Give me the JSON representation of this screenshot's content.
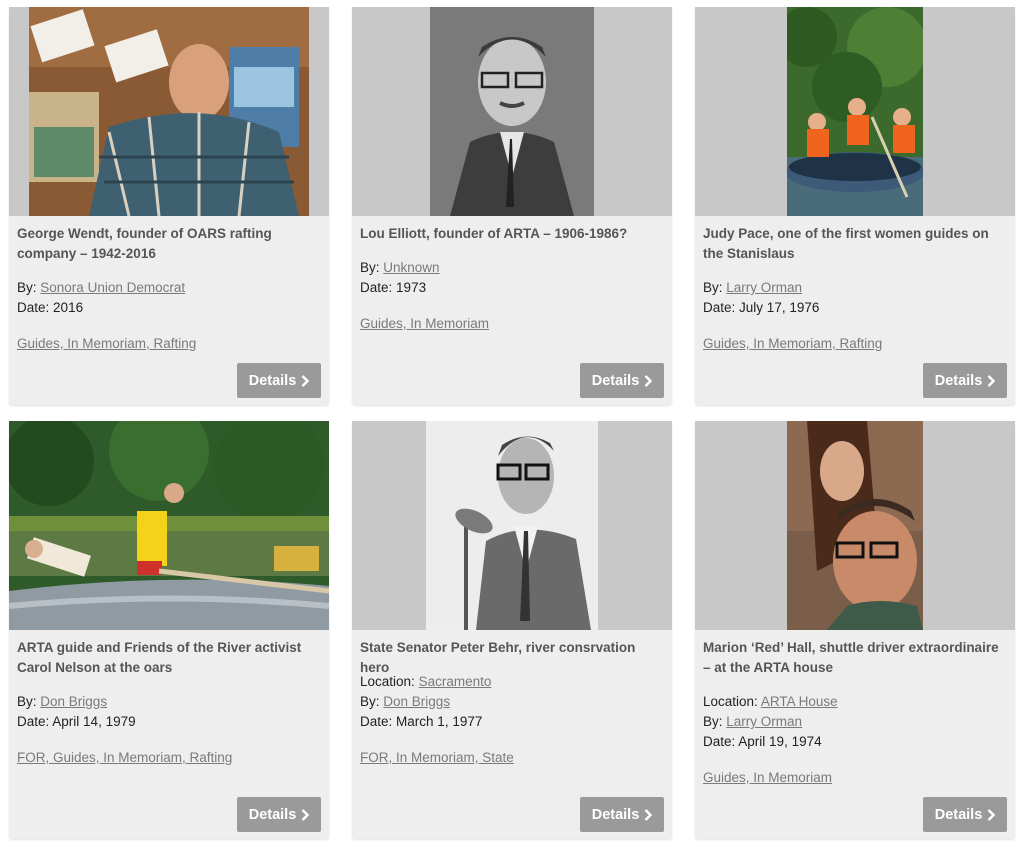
{
  "details_label": "Details",
  "cards": [
    {
      "title": "George Wendt, founder of OARS rafting company – 1942-2016",
      "by_label": "By:",
      "by": "Sonora Union Democrat",
      "date_label": "Date:",
      "date": "2016",
      "categories": "Guides, In Memoriam, Rafting",
      "photo": "photo-george-wendt"
    },
    {
      "title": "Lou Elliott, founder of ARTA – 1906-1986?",
      "by_label": "By:",
      "by": "Unknown",
      "date_label": "Date:",
      "date": "1973",
      "categories": "Guides, In Memoriam",
      "photo": "photo-lou-elliott"
    },
    {
      "title": "Judy Pace, one of the first women guides on the Stanislaus",
      "by_label": "By:",
      "by": "Larry Orman",
      "date_label": "Date:",
      "date": "July 17, 1976",
      "categories": "Guides, In Memoriam, Rafting",
      "photo": "photo-judy-pace"
    },
    {
      "title": "ARTA guide and Friends of the River activist Carol Nelson at the oars",
      "by_label": "By:",
      "by": "Don Briggs",
      "date_label": "Date:",
      "date": "April 14, 1979",
      "categories": "FOR, Guides, In Memoriam, Rafting",
      "photo": "photo-carol-nelson"
    },
    {
      "title": "State Senator Peter Behr, river consrvation hero",
      "location_label": "Location:",
      "location": "Sacramento",
      "by_label": "By:",
      "by": "Don Briggs",
      "date_label": "Date:",
      "date": "March 1, 1977",
      "categories": "FOR, In Memoriam, State",
      "photo": "photo-peter-behr"
    },
    {
      "title": "Marion ‘Red’ Hall, shuttle driver extraordinaire – at the ARTA house",
      "location_label": "Location:",
      "location": "ARTA House",
      "by_label": "By:",
      "by": "Larry Orman",
      "date_label": "Date:",
      "date": "April 19, 1974",
      "categories": "Guides, In Memoriam",
      "photo": "photo-marion-red-hall"
    }
  ]
}
